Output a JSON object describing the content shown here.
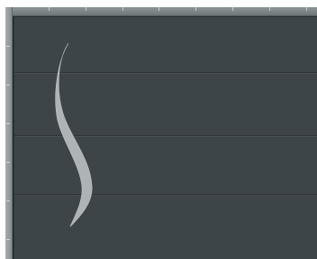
{
  "colors": {
    "ruler_top": "#7b8585",
    "ruler_left": "#9aa1a1",
    "canvas": "#3d4548",
    "separator": "#2c3235",
    "curve_fill": "#aeb4b6"
  },
  "canvas": {
    "track_count": 4
  },
  "ruler": {
    "top_ticks": 8,
    "left_ticks": 6
  }
}
